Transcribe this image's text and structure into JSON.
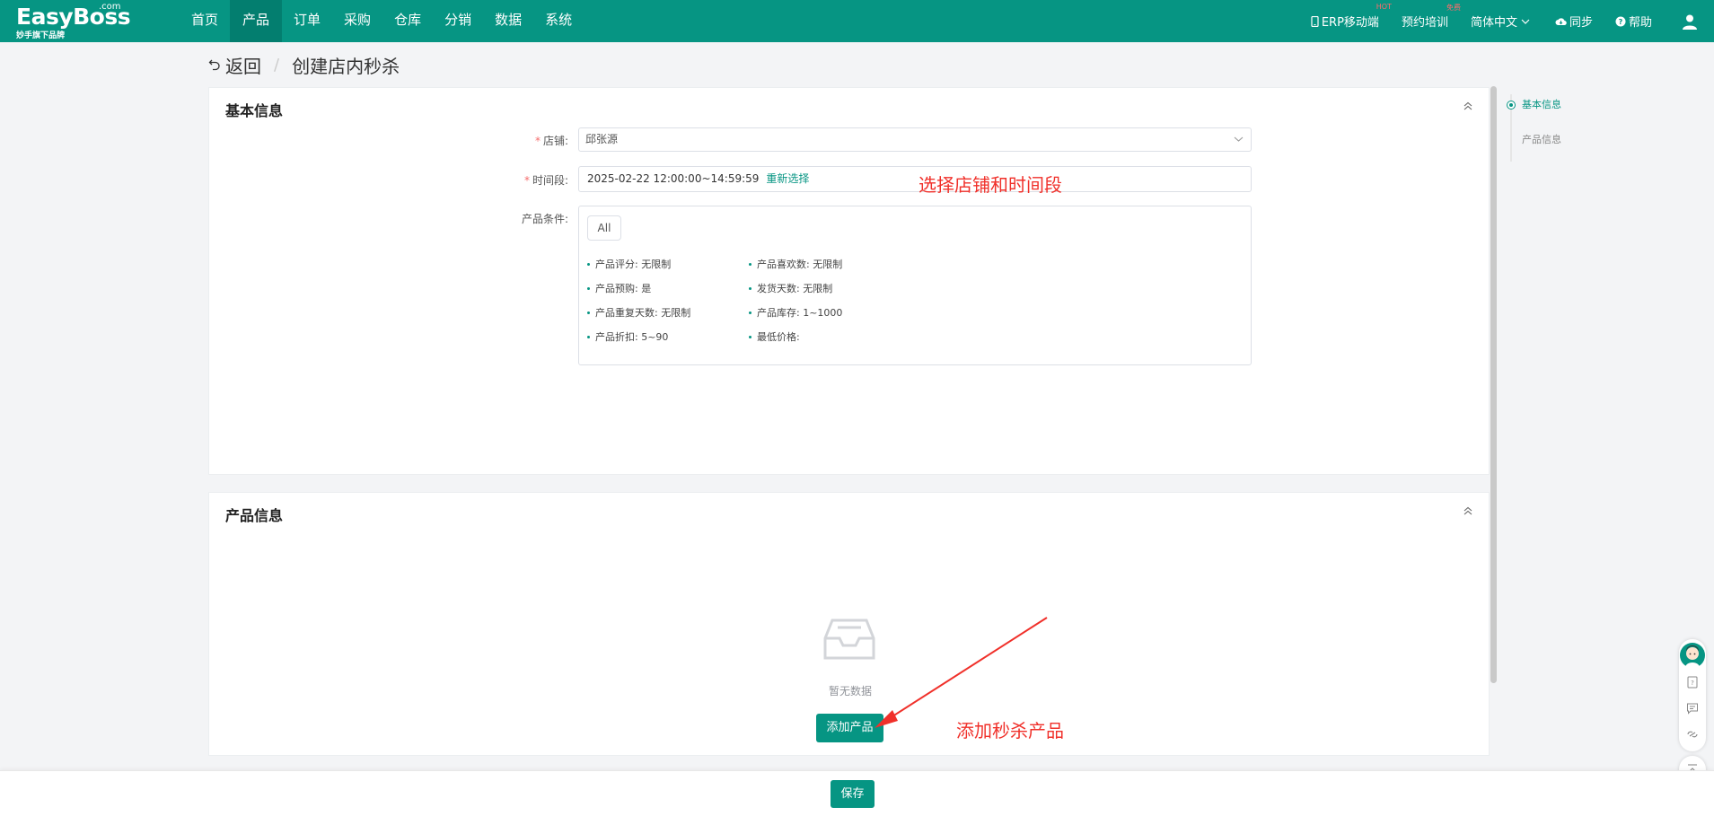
{
  "app": {
    "logo_com": ".com",
    "logo_name": "EasyBoss",
    "logo_slogan": "妙手旗下品牌"
  },
  "nav": {
    "items": [
      {
        "label": "首页"
      },
      {
        "label": "产品"
      },
      {
        "label": "订单"
      },
      {
        "label": "采购"
      },
      {
        "label": "仓库"
      },
      {
        "label": "分销"
      },
      {
        "label": "数据"
      },
      {
        "label": "系统"
      }
    ],
    "active": "产品"
  },
  "right_nav": {
    "erp_mobile": "ERP移动端",
    "erp_badge": "HOT",
    "training": "预约培训",
    "training_badge": "免费",
    "language": "简体中文",
    "sync": "同步",
    "help": "帮助"
  },
  "breadcrumb": {
    "back": "返回",
    "separator": "/",
    "current": "创建店内秒杀"
  },
  "basic_info": {
    "title": "基本信息",
    "shop_label": "店铺:",
    "shop_value": "邱张源",
    "time_label": "时间段:",
    "time_value": "2025-02-22 12:00:00~14:59:59",
    "reselect": "重新选择",
    "condition_label": "产品条件:",
    "all_button": "All",
    "conditions": [
      {
        "text": "产品评分:  无限制"
      },
      {
        "text": "产品喜欢数:  无限制"
      },
      {
        "text": "产品预购:  是"
      },
      {
        "text": "发货天数:  无限制"
      },
      {
        "text": "产品重复天数:  无限制"
      },
      {
        "text": "产品库存:  1~1000"
      },
      {
        "text": "产品折扣:  5~90"
      },
      {
        "text": "最低价格:"
      }
    ]
  },
  "annotations": {
    "select_shop_time": "选择店铺和时间段",
    "add_products": "添加秒杀产品"
  },
  "product_info": {
    "title": "产品信息",
    "empty_text": "暂无数据",
    "add_button": "添加产品"
  },
  "anchor_nav": {
    "items": [
      {
        "label": "基本信息"
      },
      {
        "label": "产品信息"
      }
    ]
  },
  "footer": {
    "save_button": "保存"
  },
  "colors": {
    "brand": "#069583",
    "annotation": "#f0302a",
    "required": "#f56c6c"
  }
}
